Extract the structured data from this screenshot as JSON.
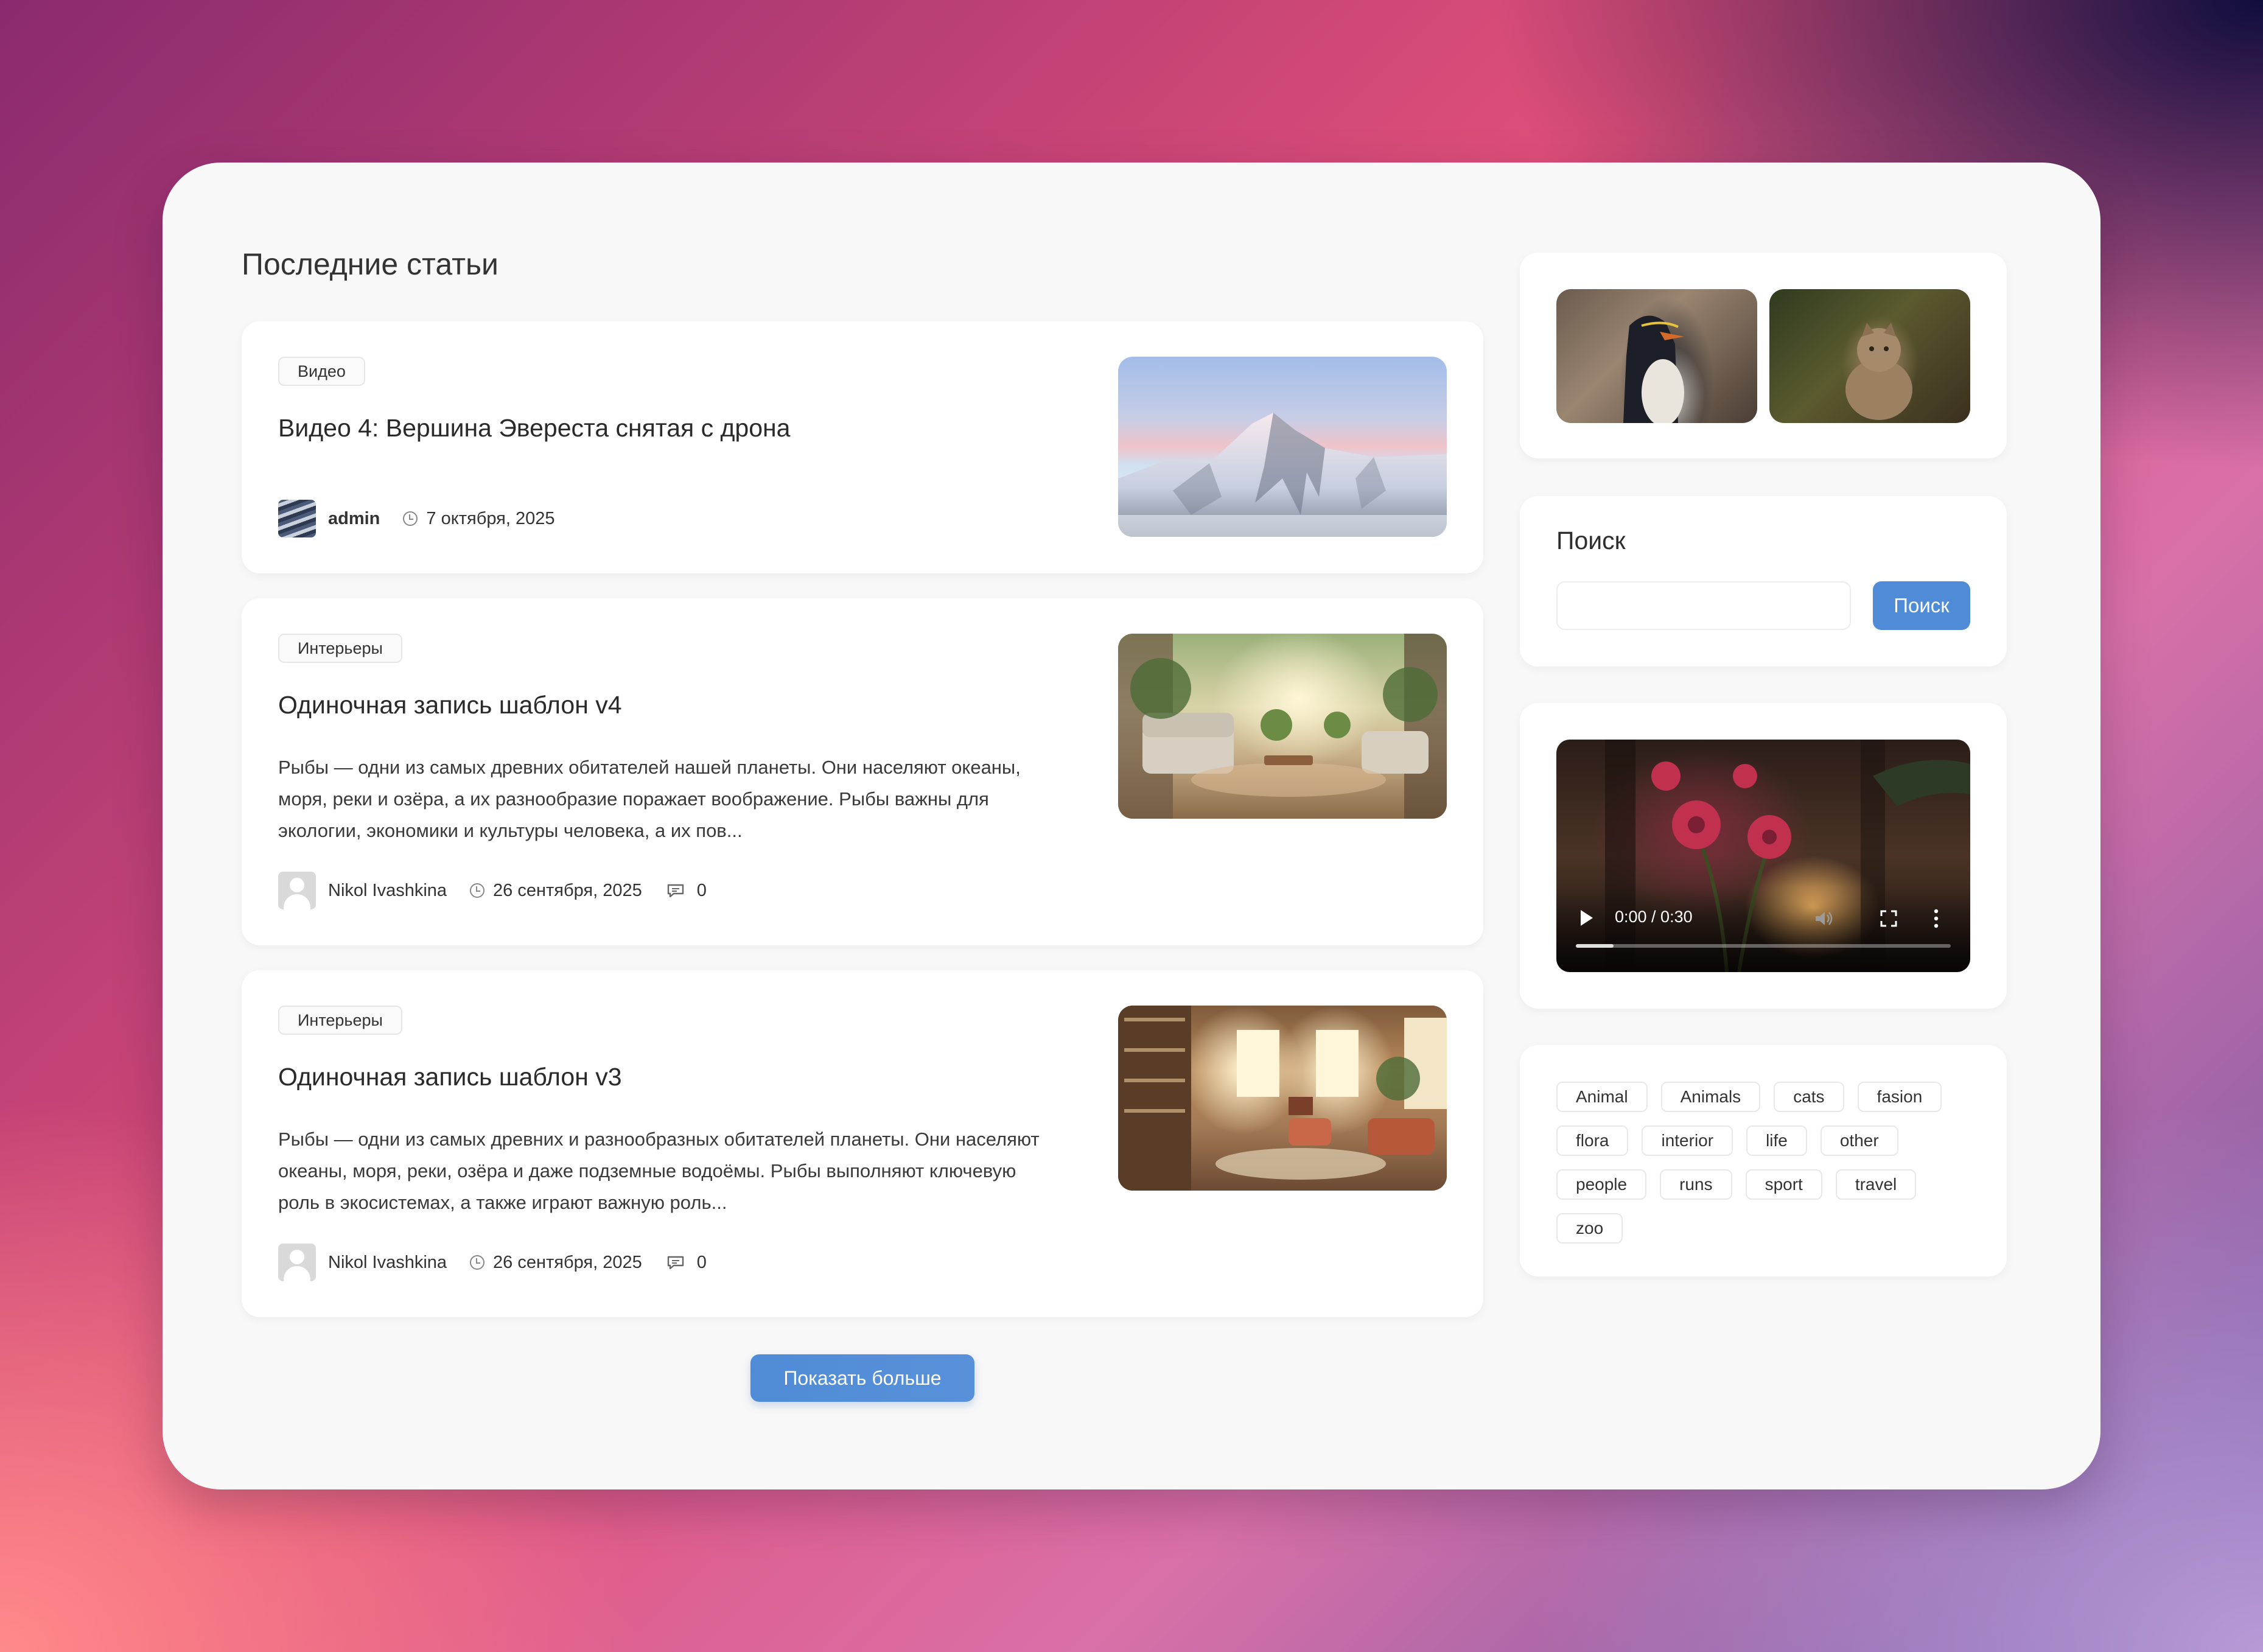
{
  "heading": "Последние статьи",
  "posts": [
    {
      "category": "Видео",
      "title": "Видео 4: Вершина Эвереста снятая с дрона",
      "author": "admin",
      "date": "7 октября, 2025"
    },
    {
      "category": "Интерьеры",
      "title": "Одиночная запись шаблон v4",
      "excerpt_lines": [
        "Рыбы — одни из самых древних обитателей нашей планеты. Они населяют океаны,",
        "моря, реки и озёра, а их разнообразие поражает воображение. Рыбы важны для",
        "экологии, экономики и культуры человека, а их пов..."
      ],
      "author": "Nikol Ivashkina",
      "date": "26 сентября, 2025",
      "comments": "0"
    },
    {
      "category": "Интерьеры",
      "title": "Одиночная запись шаблон v3",
      "excerpt_lines": [
        "Рыбы — одни из самых древних и разнообразных обитателей планеты. Они населяют",
        "океаны, моря, реки, озёра и даже подземные водоёмы. Рыбы выполняют ключевую",
        "роль в экосистемах, а также играют важную роль..."
      ],
      "author": "Nikol Ivashkina",
      "date": "26 сентября, 2025",
      "comments": "0"
    }
  ],
  "load_more_label": "Показать больше",
  "search": {
    "title": "Поиск",
    "placeholder": "",
    "button_label": "Поиск"
  },
  "video": {
    "time": "0:00 / 0:30",
    "progress": 0.1
  },
  "tags": [
    "Animal",
    "Animals",
    "cats",
    "fasion",
    "flora",
    "interior",
    "life",
    "other",
    "people",
    "runs",
    "sport",
    "travel",
    "zoo"
  ],
  "colors": {
    "accent": "#4f8bd6",
    "panel": "#f8f8f8"
  }
}
